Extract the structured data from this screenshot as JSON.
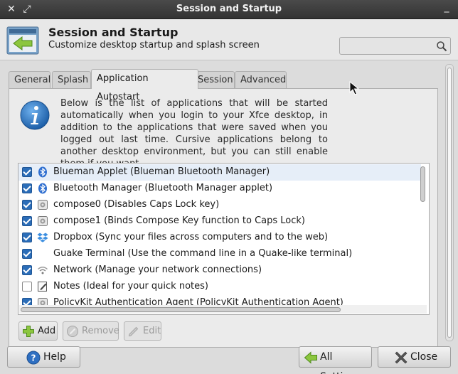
{
  "window": {
    "title": "Session and Startup"
  },
  "header": {
    "title": "Session and Startup",
    "subtitle": "Customize desktop startup and splash screen",
    "search_placeholder": ""
  },
  "tabs": [
    {
      "label": "General",
      "active": false
    },
    {
      "label": "Splash",
      "active": false
    },
    {
      "label": "Application Autostart",
      "active": true
    },
    {
      "label": "Session",
      "active": false
    },
    {
      "label": "Advanced",
      "active": false
    }
  ],
  "info": {
    "text": "Below is the list of applications that will be started automatically when you login to your Xfce desktop, in addition to the applications that were saved when you logged out last time. Cursive applications belong to another desktop environment, but you can still enable them if you want."
  },
  "autostart": [
    {
      "label": "Blueman Applet (Blueman Bluetooth Manager)",
      "checked": true,
      "icon": "bluetooth-icon"
    },
    {
      "label": "Bluetooth Manager (Bluetooth Manager applet)",
      "checked": true,
      "icon": "bluetooth-icon"
    },
    {
      "label": "compose0 (Disables Caps Lock key)",
      "checked": true,
      "icon": "generic-app-icon"
    },
    {
      "label": "compose1 (Binds Compose Key function to Caps Lock)",
      "checked": true,
      "icon": "generic-app-icon"
    },
    {
      "label": "Dropbox (Sync your files across computers and to the web)",
      "checked": true,
      "icon": "dropbox-icon"
    },
    {
      "label": "Guake Terminal (Use the command line in a Quake-like terminal)",
      "checked": true,
      "icon": "none"
    },
    {
      "label": "Network (Manage your network connections)",
      "checked": true,
      "icon": "wifi-icon"
    },
    {
      "label": "Notes (Ideal for your quick notes)",
      "checked": false,
      "icon": "notes-icon"
    },
    {
      "label": "PolicyKit Authentication Agent (PolicyKit Authentication Agent)",
      "checked": true,
      "icon": "generic-app-icon"
    }
  ],
  "actions": {
    "add": "Add",
    "remove": "Remove",
    "edit": "Edit"
  },
  "footer": {
    "help": "Help",
    "all_settings": "All Settings",
    "close": "Close"
  }
}
